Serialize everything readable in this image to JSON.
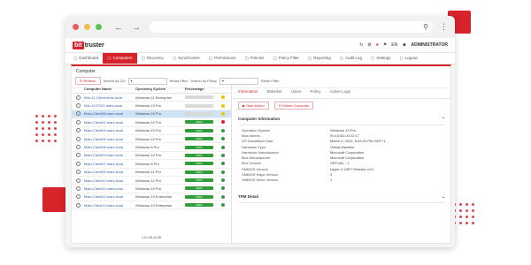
{
  "app": {
    "logo_part1": "bit",
    "logo_part2": "truster",
    "user": "ADMINISTRATOR",
    "lang": "EN"
  },
  "menu": [
    {
      "label": "Dashboard",
      "icon": "dashboard-icon",
      "active": false
    },
    {
      "label": "Computers",
      "icon": "computer-icon",
      "active": true
    },
    {
      "label": "Recovery",
      "icon": "recovery-icon",
      "active": false
    },
    {
      "label": "Synchronize",
      "icon": "sync-icon",
      "active": false
    },
    {
      "label": "Permissions",
      "icon": "permissions-icon",
      "active": false
    },
    {
      "label": "Policies",
      "icon": "policies-icon",
      "active": false
    },
    {
      "label": "Policy Filter",
      "icon": "filter-icon",
      "active": false
    },
    {
      "label": "Reporting",
      "icon": "reporting-icon",
      "active": false
    },
    {
      "label": "Audit Log",
      "icon": "audit-icon",
      "active": false
    },
    {
      "label": "Settings",
      "icon": "settings-icon",
      "active": false
    },
    {
      "label": "Logout",
      "icon": "logout-icon",
      "active": false
    }
  ],
  "panel": {
    "title": "Computer",
    "refresh": "Refresh",
    "search_ou_label": "Search by OU",
    "search_policy_label": "Search by Policy",
    "reset_filter": "Reset Filter"
  },
  "table": {
    "headers": {
      "name": "Computer Name",
      "os": "Operating System",
      "pct": "Percentage"
    },
    "rows": [
      {
        "name": "Win-11-Client.mars.local",
        "os": "Windows 11 Enterprise",
        "pct": 0,
        "status": "#f2c200",
        "sel": false
      },
      {
        "name": "Win-10-P2Z1.mars.local",
        "os": "Windows 10 Pro",
        "pct": 0,
        "status": "#f2c200",
        "sel": false
      },
      {
        "name": "Main-Client08.mars.local",
        "os": "Windows 10 Pro",
        "pct": 0,
        "status": "#f2c200",
        "sel": true
      },
      {
        "name": "Main-Client02.mars.local",
        "os": "Windows 10 Pro",
        "pct": 100,
        "status": "#d7232a",
        "sel": false
      },
      {
        "name": "Main-Client04.mars.local",
        "os": "Windows 10 Pro",
        "pct": 100,
        "status": "#2e9d3a",
        "sel": false
      },
      {
        "name": "Main-Client05.mars.local",
        "os": "Windows 10 Pro",
        "pct": 100,
        "status": "#2e9d3a",
        "sel": false
      },
      {
        "name": "Main-Client06.mars.local",
        "os": "Windows 8 Pro",
        "pct": 100,
        "status": "#2e9d3a",
        "sel": false
      },
      {
        "name": "Main-Client03.mars.local",
        "os": "Windows 10 Pro",
        "pct": 100,
        "status": "#2e9d3a",
        "sel": false
      },
      {
        "name": "Main-Client07.mars.local",
        "os": "Windows 8 Pro",
        "pct": 100,
        "status": "#2e9d3a",
        "sel": false
      },
      {
        "name": "Main-Client09.mars.local",
        "os": "Windows 11 Pro",
        "pct": 100,
        "status": "#2e9d3a",
        "sel": false
      },
      {
        "name": "Main-Client10.mars.local",
        "os": "Windows 11 Pro",
        "pct": 100,
        "status": "#2e9d3a",
        "sel": false
      },
      {
        "name": "Main-Client11.mars.local",
        "os": "Windows 10 Pro",
        "pct": 100,
        "status": "#2e9d3a",
        "sel": false
      },
      {
        "name": "Main-Client12.mars.local",
        "os": "Windows 10 Enterprise",
        "pct": 100,
        "status": "#2e9d3a",
        "sel": false
      },
      {
        "name": "Main-Client13.mars.local",
        "os": "Windows 10 Enterprise",
        "pct": 100,
        "status": "#2e9d3a",
        "sel": false
      }
    ],
    "pager": "1 to 15 of 40"
  },
  "details": {
    "tabs": [
      {
        "label": "Information",
        "active": true
      },
      {
        "label": "Bitlocker",
        "active": false
      },
      {
        "label": "Users",
        "active": false
      },
      {
        "label": "Policy",
        "active": false
      },
      {
        "label": "Active Logs",
        "active": false
      }
    ],
    "actions": [
      "Start Action",
      "Delete Computer"
    ],
    "info_title": "Computer Information",
    "info": [
      {
        "k": "Operation System",
        "v": "Windows 10 Pro"
      },
      {
        "k": "Mac Adress",
        "v": "00:15:5D:00:22:17"
      },
      {
        "k": "OS Installation Date",
        "v": "March 5, 2024, 8:49:23 PM GMT+1"
      },
      {
        "k": "Hardware Type",
        "v": "Virtual Machine"
      },
      {
        "k": "Hardware Manufacturer",
        "v": "Microsoft Corporation"
      },
      {
        "k": "Bios Manufacturer",
        "v": "Microsoft Corporation"
      },
      {
        "k": "Bios Version",
        "v": "VRTUAL - 1"
      },
      {
        "k": "SMBIOS Version",
        "v": "Hyper-V UEFI Release v4.0"
      },
      {
        "k": "SMBIOS Major Version",
        "v": "3"
      },
      {
        "k": "SMBIOS Minor Version",
        "v": "1"
      }
    ],
    "tpm_title": "TPM Detail"
  },
  "colors": {
    "accent": "#d7232a",
    "ok": "#2e9d3a",
    "warn": "#f2c200"
  }
}
